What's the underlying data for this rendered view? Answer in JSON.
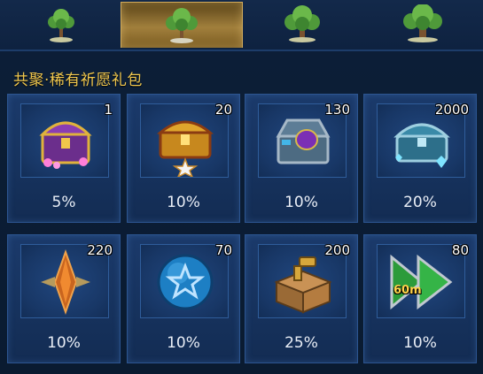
{
  "tabs": [
    {
      "icon": "tree-small-icon",
      "active": false
    },
    {
      "icon": "tree-glowing-icon",
      "active": true
    },
    {
      "icon": "tree-large-icon",
      "active": false
    },
    {
      "icon": "tree-ancient-icon",
      "active": false
    }
  ],
  "title": "共聚·稀有祈愿礼包",
  "items": [
    {
      "icon": "purple-chest-icon",
      "quantity": "1",
      "chance": "5%"
    },
    {
      "icon": "golden-chest-icon",
      "quantity": "20",
      "chance": "10%"
    },
    {
      "icon": "steel-chest-icon",
      "quantity": "130",
      "chance": "10%"
    },
    {
      "icon": "ice-chest-icon",
      "quantity": "2000",
      "chance": "20%"
    },
    {
      "icon": "orange-crystal-icon",
      "quantity": "220",
      "chance": "10%"
    },
    {
      "icon": "blue-star-orb-icon",
      "quantity": "70",
      "chance": "10%"
    },
    {
      "icon": "supply-crate-icon",
      "quantity": "200",
      "chance": "25%"
    },
    {
      "icon": "speedup-arrows-icon",
      "quantity": "80",
      "chance": "10%",
      "badge": "60m"
    }
  ],
  "colors": {
    "title": "#f1c84f",
    "card_bg": "#1b3a6b",
    "active_tab": "#a17f3c"
  }
}
